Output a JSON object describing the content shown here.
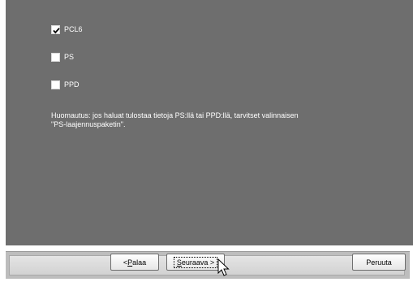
{
  "options": [
    {
      "label": "PCL6",
      "checked": true
    },
    {
      "label": "PS",
      "checked": false
    },
    {
      "label": "PPD",
      "checked": false
    }
  ],
  "note": {
    "line1": "Huomautus: jos haluat tulostaa tietoja PS:llä tai PPD:llä, tarvitset valinnaisen",
    "line2": "\"PS-laajennuspaketin\"."
  },
  "buttons": {
    "back_prefix": "< ",
    "back_accel": "P",
    "back_rest": "alaa",
    "next_accel": "S",
    "next_rest": "euraava >",
    "cancel": "Peruuta"
  },
  "icons": {
    "checkbox_checked": "check-mark-icon",
    "cursor": "mouse-pointer-icon"
  }
}
